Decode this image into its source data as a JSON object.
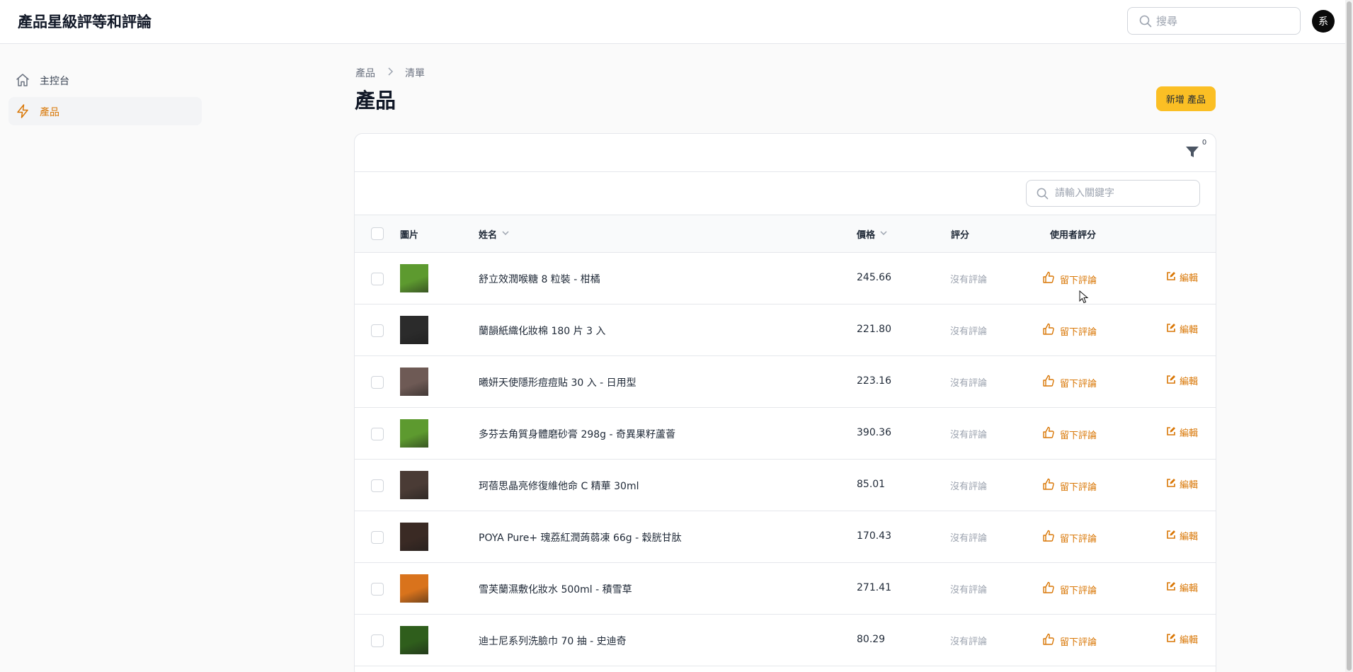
{
  "app": {
    "title": "產品星級評等和評論"
  },
  "top_search": {
    "placeholder": "搜尋"
  },
  "user": {
    "avatar_initial": "系"
  },
  "sidebar": {
    "items": [
      {
        "label": "主控台",
        "icon": "home-icon",
        "active": false
      },
      {
        "label": "產品",
        "icon": "lightning-icon",
        "active": true
      }
    ]
  },
  "breadcrumb": {
    "parent": "產品",
    "current": "清單"
  },
  "page": {
    "title": "產品",
    "new_button": "新增 產品"
  },
  "table": {
    "filter_count": "0",
    "search_placeholder": "請輸入關鍵字",
    "columns": {
      "image": "圖片",
      "name": "姓名",
      "price": "價格",
      "rating": "評分",
      "user_rating": "使用者評分"
    },
    "rows": [
      {
        "name": "舒立效潤喉糖 8 粒裝 - 柑橘",
        "price": "245.66",
        "rating": "沒有評論",
        "review": "留下評論",
        "edit": "編輯",
        "image_color": "#5d9a2f"
      },
      {
        "name": "蘭韻紙織化妝棉 180 片 3 入",
        "price": "221.80",
        "rating": "沒有評論",
        "review": "留下評論",
        "edit": "編輯",
        "image_color": "#2b2b2b"
      },
      {
        "name": "曦妍天使隱形痘痘貼 30 入 - 日用型",
        "price": "223.16",
        "rating": "沒有評論",
        "review": "留下評論",
        "edit": "編輯",
        "image_color": "#6e5a55"
      },
      {
        "name": "多芬去角質身體磨砂膏 298g - 奇異果籽蘆薈",
        "price": "390.36",
        "rating": "沒有評論",
        "review": "留下評論",
        "edit": "編輯",
        "image_color": "#5d9a2f"
      },
      {
        "name": "珂蓓思晶亮修復維他命 C 精華 30ml",
        "price": "85.01",
        "rating": "沒有評論",
        "review": "留下評論",
        "edit": "編輯",
        "image_color": "#4a3b35"
      },
      {
        "name": "POYA Pure+ 瑰荔紅潤蒟蒻凍 66g - 穀胱甘肽",
        "price": "170.43",
        "rating": "沒有評論",
        "review": "留下評論",
        "edit": "編輯",
        "image_color": "#3a2a24"
      },
      {
        "name": "雪芙蘭濕敷化妝水 500ml - 積雪草",
        "price": "271.41",
        "rating": "沒有評論",
        "review": "留下評論",
        "edit": "編輯",
        "image_color": "#d9731c"
      },
      {
        "name": "迪士尼系列洗臉巾 70 抽 - 史迪奇",
        "price": "80.29",
        "rating": "沒有評論",
        "review": "留下評論",
        "edit": "編輯",
        "image_color": "#2f5e1c"
      }
    ]
  },
  "colors": {
    "accent": "#d97706",
    "button": "#fbbf24"
  }
}
